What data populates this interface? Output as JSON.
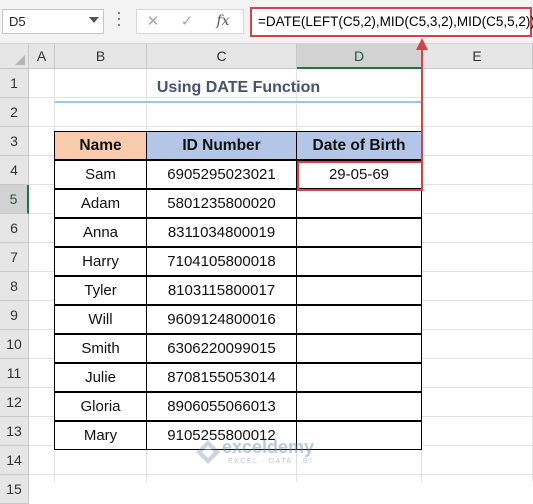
{
  "formula_bar": {
    "name_box": "D5",
    "cancel_icon": "✕",
    "enter_icon": "✓",
    "fx_label": "fx",
    "formula": "=DATE(LEFT(C5,2),MID(C5,3,2),MID(C5,5,2))"
  },
  "columns": [
    "A",
    "B",
    "C",
    "D",
    "E"
  ],
  "rows": [
    "1",
    "2",
    "3",
    "4",
    "5",
    "6",
    "7",
    "8",
    "9",
    "10",
    "11",
    "12",
    "13",
    "14",
    "15"
  ],
  "title": "Using DATE Function",
  "table": {
    "headers": {
      "name": "Name",
      "id": "ID Number",
      "dob": "Date of Birth"
    },
    "rows": [
      {
        "name": "Sam",
        "id": "6905295023021",
        "dob": "29-05-69"
      },
      {
        "name": "Adam",
        "id": "5801235800020",
        "dob": ""
      },
      {
        "name": "Anna",
        "id": "8311034800019",
        "dob": ""
      },
      {
        "name": "Harry",
        "id": "7104105800018",
        "dob": ""
      },
      {
        "name": "Tyler",
        "id": "8103115800017",
        "dob": ""
      },
      {
        "name": "Will",
        "id": "9609124800016",
        "dob": ""
      },
      {
        "name": "Smith",
        "id": "6306220099015",
        "dob": ""
      },
      {
        "name": "Julie",
        "id": "8708155053014",
        "dob": ""
      },
      {
        "name": "Gloria",
        "id": "8906055066013",
        "dob": ""
      },
      {
        "name": "Mary",
        "id": "9105255800012",
        "dob": ""
      }
    ]
  },
  "watermark": {
    "brand": "exceldemy",
    "tagline": "EXCEL · DATA · BI"
  },
  "colors": {
    "highlight": "#d9404b",
    "name_header": "#f8cbad",
    "header_blue": "#b4c6e7",
    "excel_green": "#217346"
  }
}
